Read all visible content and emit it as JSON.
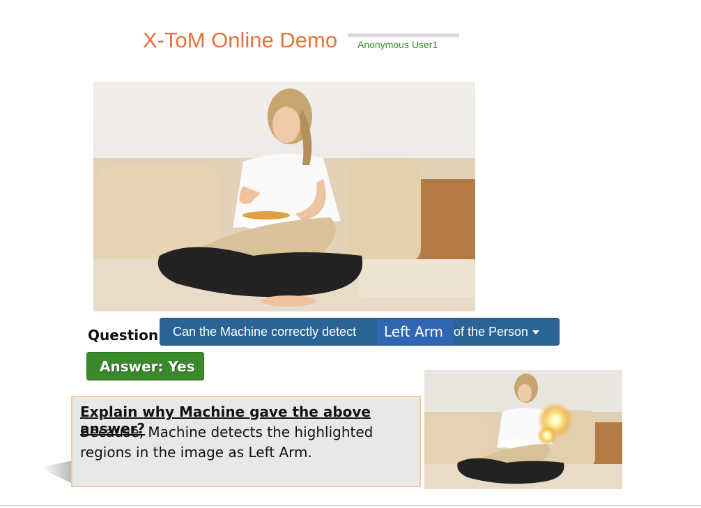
{
  "header": {
    "title": "X-ToM Online Demo",
    "user": "Anonymous User1"
  },
  "image": {
    "main_alt": "Woman sitting cross-legged on a sofa holding a bowl of chips",
    "thumb_alt": "Same image with the highlighted left arm region"
  },
  "question": {
    "label": "Question",
    "colon": ":",
    "prefix": "Can the Machine correctly detect",
    "selected": "Left Arm",
    "suffix": "of the Person",
    "dropdown_icon": "caret-down-icon"
  },
  "answer": {
    "label": "Answer: Yes"
  },
  "explanation": {
    "question": "Explain why Machine gave the above answer?",
    "line1": "Because, Machine detects the highlighted",
    "line2": "regions in the image as Left Arm."
  },
  "colors": {
    "title": "#e2733a",
    "user": "#3a8a2e",
    "question_bar": "#2a6496",
    "selected_bg": "#3066b2",
    "answer_bg": "#3a8a2c",
    "explain_border": "#f3c99e"
  }
}
